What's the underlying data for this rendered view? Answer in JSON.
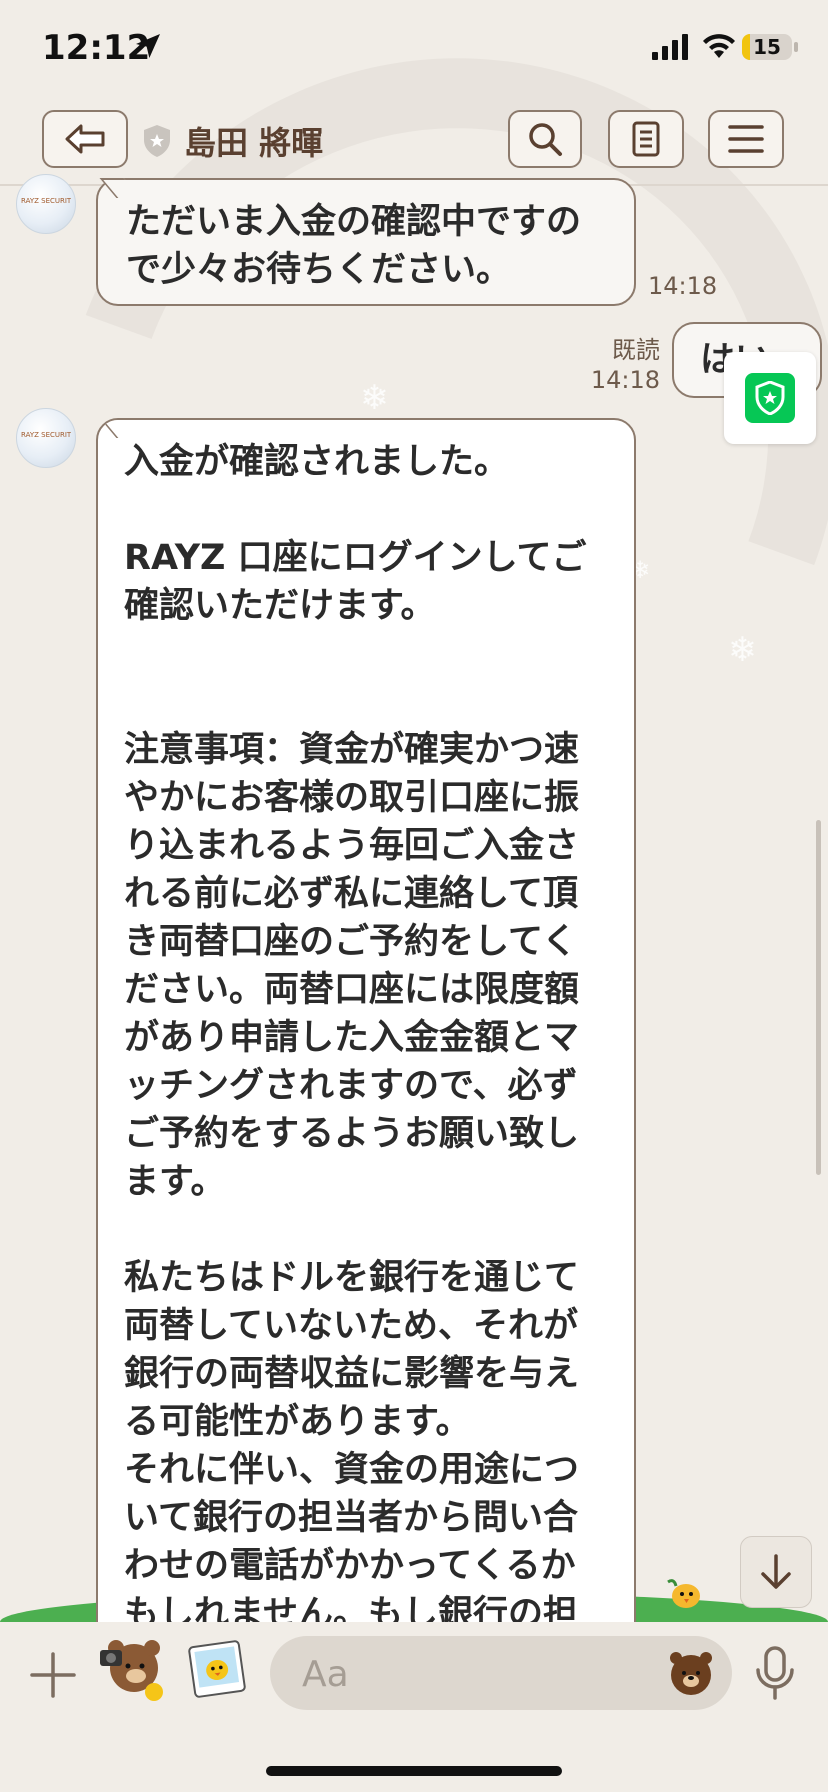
{
  "status_bar": {
    "time": "12:12",
    "battery_level": "15"
  },
  "header": {
    "contact_name": "島田 將暉"
  },
  "messages": [
    {
      "side": "left",
      "avatar_text": "RAYZ SECURITIES",
      "text": "ただいま入金の確認中ですので少々お待ちください。",
      "time": "14:18"
    },
    {
      "side": "right",
      "text": "はい",
      "read_label": "既読",
      "time": "14:18"
    },
    {
      "side": "left",
      "avatar_text": "RAYZ SECURITIES",
      "text": "入金が確認されました。\n\nRAYZ 口座にログインしてご確認いただけます。\n\n\n注意事項：資金が確実かつ速やかにお客様の取引口座に振り込まれるよう毎回ご入金される前に必ず私に連絡して頂き両替口座のご予約をしてください。両替口座には限度額があり申請した入金金額とマッチングされますので、必ずご予約をするようお願い致します。\n\n私たちはドルを銀行を通じて両替していないため、それが銀行の両替収益に影響を与える可能性があります。\nそれに伴い、資金の用途について銀行の担当者から問い合わせの電話がかかってくるかもしれません。もし銀行の担"
    }
  ],
  "input": {
    "placeholder": "Aa"
  },
  "colors": {
    "accent_green": "#06c755",
    "bubble_border": "#8c7a6c",
    "background": "#f1ede7"
  },
  "icons": [
    "location-arrow-icon",
    "signal-icon",
    "wifi-icon",
    "battery-icon",
    "back-icon",
    "shield-icon",
    "search-icon",
    "notes-icon",
    "menu-icon",
    "plus-icon",
    "sticker-icon",
    "emoji-icon",
    "mic-icon",
    "arrow-down-icon"
  ]
}
